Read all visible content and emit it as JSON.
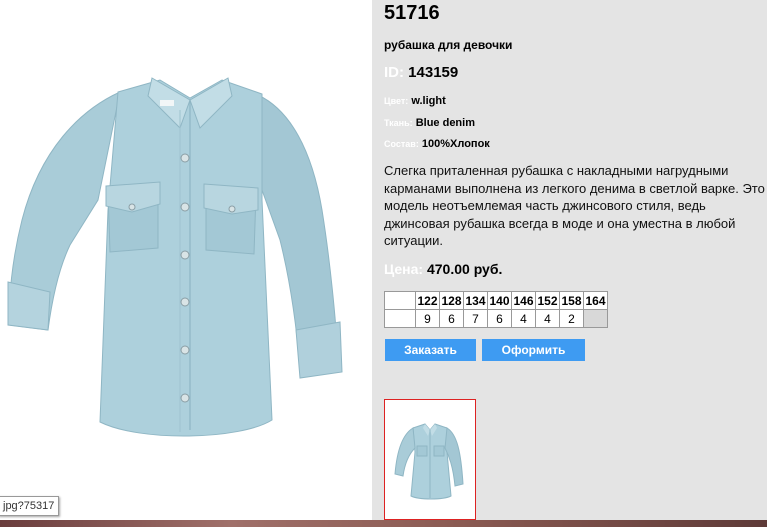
{
  "product": {
    "article": "51716",
    "name": "рубашка для девочки",
    "id_label": "ID:",
    "id_value": "143159",
    "color_label": "Цвет:",
    "color_value": "w.light",
    "fabric_label": "Ткань:",
    "fabric_value": "Blue denim",
    "composition_label": "Состав:",
    "composition_value": "100%Хлопок",
    "description": "Слегка приталенная рубашка с накладными нагрудными карманами выполнена из легкого денима в светлой варке. Это модель неотъемлемая часть джинсового стиля, ведь джинсовая рубашка всегда в моде и она уместна в любой ситуации.",
    "price_label": "Цена:",
    "price_value": "470.00 руб."
  },
  "sizes": {
    "headers": [
      "122",
      "128",
      "134",
      "140",
      "146",
      "152",
      "158",
      "164"
    ],
    "quantities": [
      "9",
      "6",
      "7",
      "6",
      "4",
      "4",
      "2",
      ""
    ]
  },
  "buttons": {
    "order": "Заказать",
    "checkout": "Оформить"
  },
  "image": {
    "tooltip": "jpg?75317"
  },
  "colors": {
    "accent_button": "#3e9bf2",
    "panel_bg": "#e4e4e4",
    "thumb_border": "#dd2222",
    "denim": "#a8ccd8"
  }
}
